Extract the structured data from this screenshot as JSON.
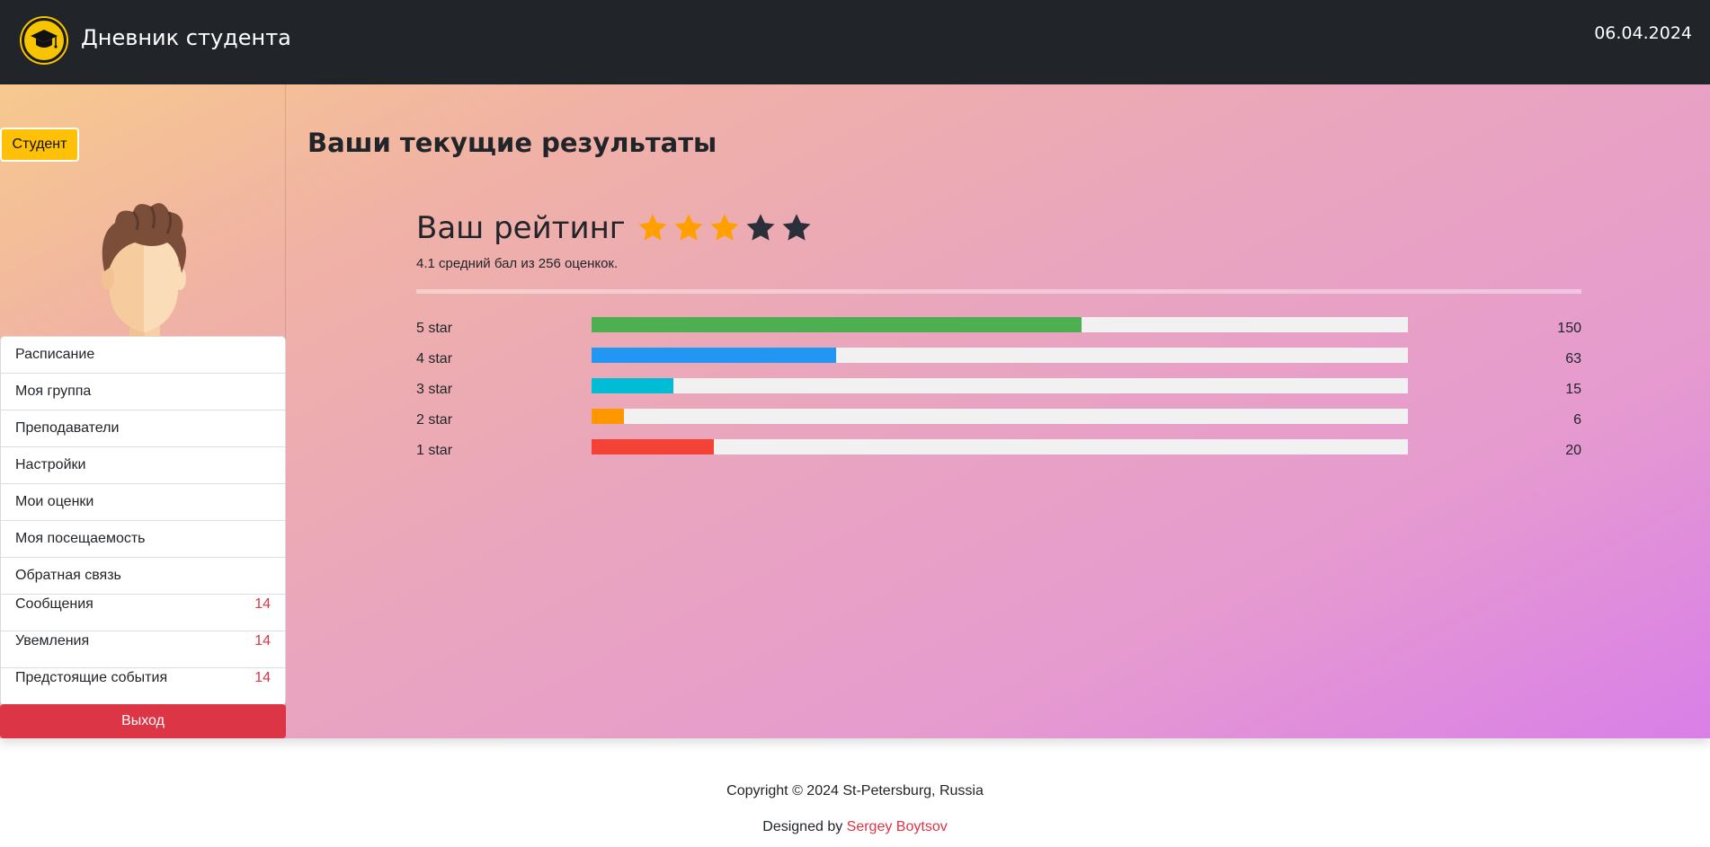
{
  "header": {
    "title": "Дневник студента",
    "date": "06.04.2024",
    "logo_icon": "graduation-cap-icon"
  },
  "sidebar": {
    "role_badge": "Студент",
    "avatar_icon": "student-avatar",
    "items": [
      {
        "label": "Расписание"
      },
      {
        "label": "Моя группа"
      },
      {
        "label": "Преподаватели"
      },
      {
        "label": "Настройки"
      },
      {
        "label": "Мои оценки"
      },
      {
        "label": "Моя посещаемость"
      },
      {
        "label": "Обратная связь"
      },
      {
        "label": "Сообщения",
        "count": "14"
      },
      {
        "label": "Увемления",
        "count": "14"
      },
      {
        "label": "Предстоящие события",
        "count": "14"
      }
    ],
    "logout_label": "Выход"
  },
  "main": {
    "title": "Ваши текущие результаты",
    "rating": {
      "heading": "Ваш рейтинг",
      "stars_filled": 3,
      "stars_total": 5,
      "summary": "4.1 средний бал из 256 оценкок.",
      "star_color_filled": "#ffa000",
      "star_color_empty": "#2b2f3a"
    },
    "breakdown": [
      {
        "label": "5 star",
        "count": "150",
        "fraction": 0.6,
        "color": "#4caf50"
      },
      {
        "label": "4 star",
        "count": "63",
        "fraction": 0.3,
        "color": "#2196f3"
      },
      {
        "label": "3 star",
        "count": "15",
        "fraction": 0.1,
        "color": "#00bcd4"
      },
      {
        "label": "2 star",
        "count": "6",
        "fraction": 0.04,
        "color": "#ff9800"
      },
      {
        "label": "1 star",
        "count": "20",
        "fraction": 0.15,
        "color": "#f44336"
      }
    ]
  },
  "footer": {
    "copyright": "Copyright © 2024 St-Petersburg, Russia",
    "designed_prefix": "Designed by ",
    "designer": "Sergey Boytsov"
  }
}
